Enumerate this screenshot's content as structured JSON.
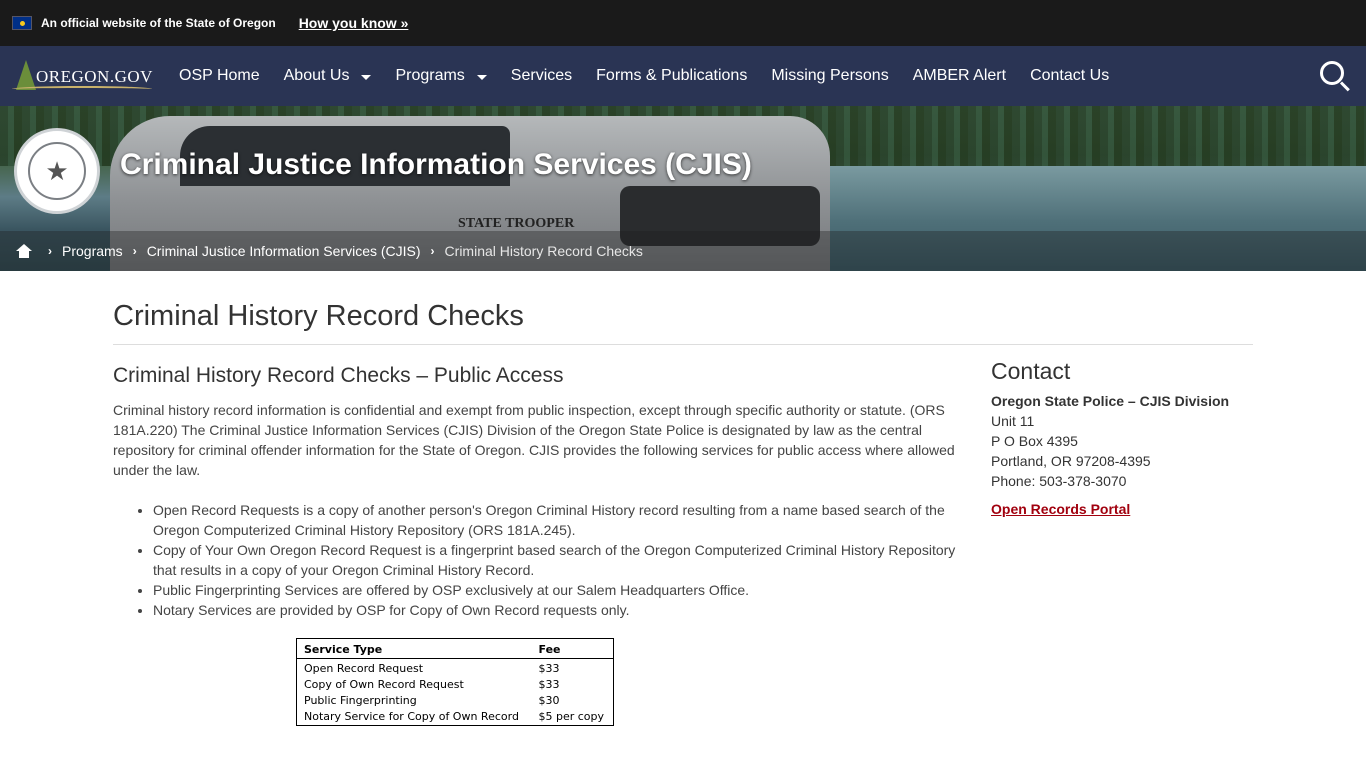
{
  "banner": {
    "official_text": "An official website of the State of Oregon",
    "how_link": "How you know »"
  },
  "nav": {
    "logo_text": "OREGON.GOV",
    "items": [
      {
        "label": "OSP Home",
        "dropdown": false
      },
      {
        "label": "About Us",
        "dropdown": true
      },
      {
        "label": "Programs",
        "dropdown": true
      },
      {
        "label": "Services",
        "dropdown": false
      },
      {
        "label": "Forms & Publications",
        "dropdown": false
      },
      {
        "label": "Missing Persons",
        "dropdown": false
      },
      {
        "label": "AMBER Alert",
        "dropdown": false
      },
      {
        "label": "Contact Us",
        "dropdown": false
      }
    ],
    "search_icon": "search-icon"
  },
  "hero": {
    "title": "Criminal Justice Information Services (CJIS)",
    "vehicle_label": "STATE TROOPER",
    "breadcrumbs": [
      "Programs",
      "Criminal Justice Information Services (CJIS)",
      "Criminal History Record Checks"
    ]
  },
  "page": {
    "title": "Criminal History Record Checks",
    "section_heading": "Criminal History Record Checks – Public Access",
    "intro": "Criminal history record information is confidential and exempt from public inspection, except through specific authority or statute.  (ORS 181A.220) The Criminal Justice Information Services (CJIS) Division of the Oregon State Police is designated by law as the central repository for criminal offender information for the State of Oregon.   CJIS provides the following services for public access where allowed under the law.",
    "bullets": [
      "Open Record Requests is a copy of another person's Oregon Criminal History record resulting from a name based search of the Oregon Computerized Criminal History Repository (ORS 181A.245).",
      "Copy of Your Own Oregon Record Request is a fingerprint based search of the Oregon Computerized Criminal History Repository that results in a copy of your Oregon Criminal History Record.",
      "Public Fingerprinting Services are offered by OSP exclusively at our Salem Headquarters Office.",
      "Notary Services are provided by OSP for Copy of Own Record requests only."
    ],
    "fee_table": {
      "headers": [
        "Service Type",
        "Fee"
      ],
      "rows": [
        [
          "Open Record Request",
          "$33"
        ],
        [
          "Copy of Own Record Request",
          "$33"
        ],
        [
          "Public Fingerprinting",
          "$30"
        ],
        [
          "Notary Service for Copy of Own Record",
          "$5 per copy"
        ]
      ]
    }
  },
  "sidebar": {
    "heading": "Contact",
    "org": "Oregon State Police – CJIS Division",
    "lines": [
      "Unit 11",
      "P O Box 4395",
      "Portland, OR 97208-4395",
      "Phone: 503-378-3070"
    ],
    "portal_link": "Open Records Portal",
    "link_color": "#a1000e"
  },
  "colors": {
    "banner_bg": "#1a1a1a",
    "nav_bg": "#2a3454"
  }
}
